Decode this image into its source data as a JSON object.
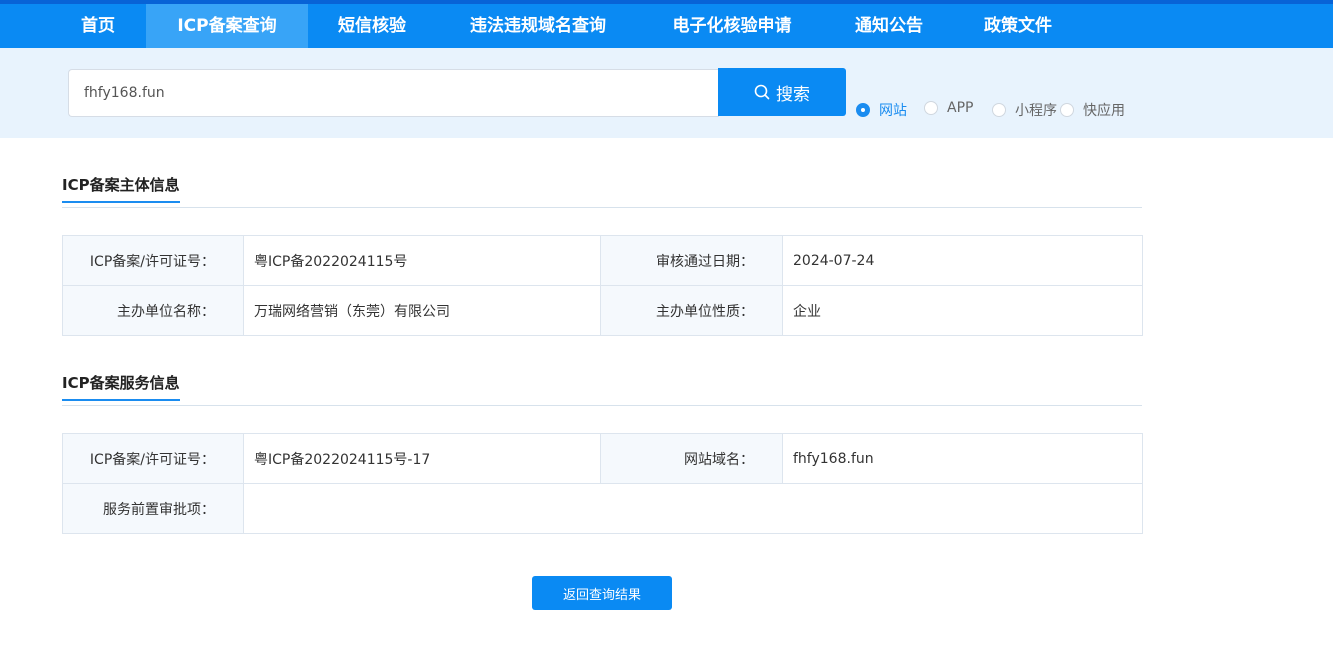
{
  "nav": {
    "items": [
      {
        "label": "首页",
        "active": false
      },
      {
        "label": "ICP备案查询",
        "active": true
      },
      {
        "label": "短信核验",
        "active": false
      },
      {
        "label": "违法违规域名查询",
        "active": false
      },
      {
        "label": "电子化核验申请",
        "active": false
      },
      {
        "label": "通知公告",
        "active": false
      },
      {
        "label": "政策文件",
        "active": false
      }
    ]
  },
  "search": {
    "value": "fhfy168.fun",
    "button_label": "搜索",
    "types": [
      {
        "label": "网站",
        "checked": true
      },
      {
        "label": "APP",
        "checked": false
      },
      {
        "label": "小程序",
        "checked": false
      },
      {
        "label": "快应用",
        "checked": false
      }
    ]
  },
  "subject_section": {
    "title": "ICP备案主体信息",
    "license_label": "ICP备案/许可证号：",
    "license_value": "粤ICP备2022024115号",
    "approval_date_label": "审核通过日期：",
    "approval_date_value": "2024-07-24",
    "org_name_label": "主办单位名称：",
    "org_name_value": "万瑞网络营销（东莞）有限公司",
    "org_type_label": "主办单位性质：",
    "org_type_value": "企业"
  },
  "service_section": {
    "title": "ICP备案服务信息",
    "license_label": "ICP备案/许可证号：",
    "license_value": "粤ICP备2022024115号-17",
    "domain_label": "网站域名：",
    "domain_value": "fhfy168.fun",
    "pre_approval_label": "服务前置审批项：",
    "pre_approval_value": ""
  },
  "back_button_label": "返回查询结果",
  "colors": {
    "primary": "#0a8af3",
    "nav_active": "#38a4f7",
    "search_band": "#e8f3fd",
    "label_cell": "#f5f9fd"
  }
}
